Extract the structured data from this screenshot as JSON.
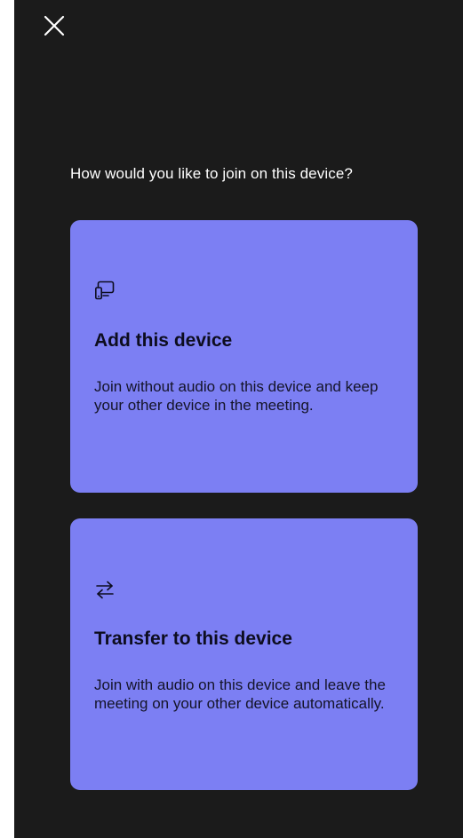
{
  "icons": {
    "close": "close-icon",
    "add_device": "device-pair-icon",
    "transfer": "transfer-arrows-icon"
  },
  "colors": {
    "background": "#1b1b1b",
    "card": "#7c7ff3",
    "card_text": "#0d0d1f",
    "prompt_text": "#ffffff"
  },
  "prompt": "How would you like to join on this device?",
  "cards": [
    {
      "title": "Add this device",
      "description": "Join without audio on this device and keep your other device in the meeting."
    },
    {
      "title": "Transfer to this device",
      "description": "Join with audio on this device and leave the meeting on your other device automatically."
    }
  ]
}
